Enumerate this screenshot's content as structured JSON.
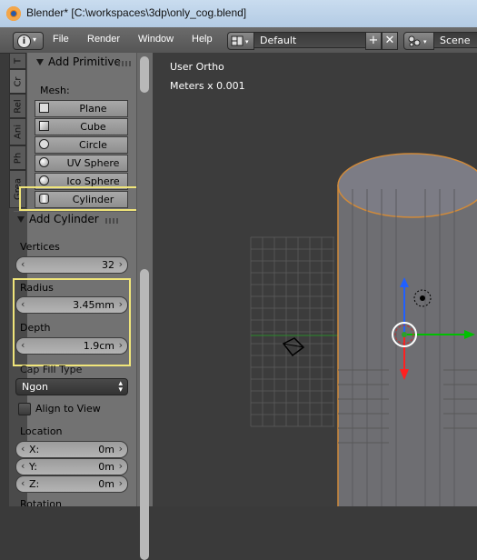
{
  "window": {
    "title": "Blender* [C:\\workspaces\\3dp\\only_cog.blend]"
  },
  "menubar": {
    "info_icon": "info-icon",
    "items": [
      "File",
      "Render",
      "Window",
      "Help"
    ],
    "screen_layout": "Default",
    "scene": "Scene"
  },
  "tabs": [
    "T",
    "Cr",
    "Rel",
    "Ani",
    "Ph",
    "Grea"
  ],
  "toolshelf": {
    "add_primitive": {
      "header": "Add Primitive",
      "mesh_label": "Mesh:",
      "buttons": [
        {
          "label": "Plane",
          "icon": "plane-icon"
        },
        {
          "label": "Cube",
          "icon": "cube-icon"
        },
        {
          "label": "Circle",
          "icon": "circle-icon"
        },
        {
          "label": "UV Sphere",
          "icon": "uv-sphere-icon"
        },
        {
          "label": "Ico Sphere",
          "icon": "ico-sphere-icon"
        },
        {
          "label": "Cylinder",
          "icon": "cylinder-icon"
        }
      ]
    },
    "operator": {
      "header": "Add Cylinder",
      "vertices_label": "Vertices",
      "vertices_value": "32",
      "radius_label": "Radius",
      "radius_value": "3.45mm",
      "depth_label": "Depth",
      "depth_value": "1.9cm",
      "cap_fill_label": "Cap Fill Type",
      "cap_fill_value": "Ngon",
      "align_label": "Align to View",
      "location_label": "Location",
      "location": [
        {
          "axis": "X:",
          "value": "0m"
        },
        {
          "axis": "Y:",
          "value": "0m"
        },
        {
          "axis": "Z:",
          "value": "0m"
        }
      ],
      "rotation_label": "Rotation"
    }
  },
  "viewport": {
    "view_name": "User Ortho",
    "units": "Meters x 0.001"
  },
  "colors": {
    "highlight": "#f0e57a",
    "x_axis": "#00c000",
    "y_axis": "#ff2020",
    "z_axis": "#2060ff",
    "selection_outline": "#e8a050"
  }
}
